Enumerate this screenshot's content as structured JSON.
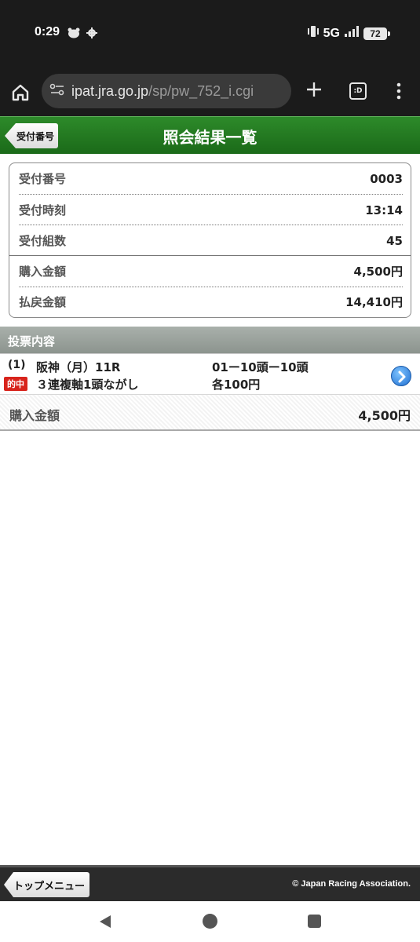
{
  "status_bar": {
    "time": "0:29",
    "network": "5G",
    "battery": "72"
  },
  "browser": {
    "url_host": "ipat.jra.go.jp",
    "url_path": "/sp/pw_752_i.cgi",
    "tabs_label": ":D"
  },
  "header": {
    "back_label": "受付番号",
    "title": "照会結果一覧"
  },
  "summary": {
    "rows": [
      {
        "label": "受付番号",
        "value": "0003"
      },
      {
        "label": "受付時刻",
        "value": "13:14"
      },
      {
        "label": "受付組数",
        "value": "45"
      },
      {
        "label": "購入金額",
        "value": "4,500円"
      },
      {
        "label": "払戻金額",
        "value": "14,410円"
      }
    ]
  },
  "bets": {
    "section_title": "投票内容",
    "item": {
      "number": "(1)",
      "venue": "阪神（月）11R",
      "combination": "01ー10頭ー10頭",
      "hit_badge": "的中",
      "bet_type": "３連複軸1頭ながし",
      "amount_each": "各100円"
    },
    "total_label": "購入金額",
    "total_value": "4,500円"
  },
  "footer": {
    "top_menu_label": "トップメニュー",
    "copyright": "© Japan Racing Association."
  },
  "colors": {
    "header_green": "#1b6a19",
    "hit_red": "#d8241c",
    "section_gray": "#8c948e"
  }
}
